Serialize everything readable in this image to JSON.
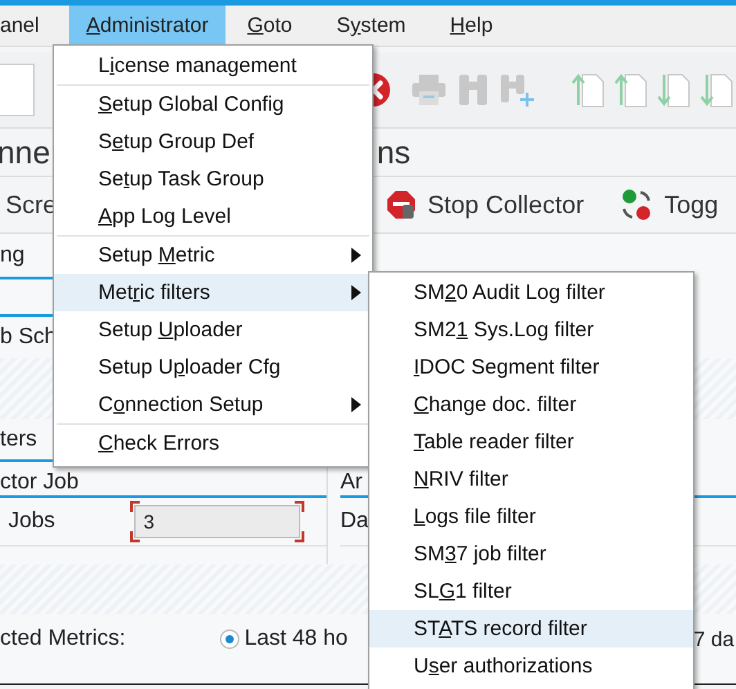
{
  "menubar": [
    {
      "text_after": "anel",
      "selected": false
    },
    {
      "key": "A",
      "text_after": "dministrator",
      "selected": true
    },
    {
      "key": "G",
      "text_after": "oto",
      "selected": false
    },
    {
      "text_before": "S",
      "key": "y",
      "text_after": "stem",
      "selected": false
    },
    {
      "key": "H",
      "text_after": "elp",
      "selected": false
    }
  ],
  "title_fragments": [
    "nne",
    "ns"
  ],
  "app_toolbar": [
    {
      "kind": "plain",
      "label": "Scre"
    },
    {
      "kind": "stop",
      "label": "Stop Collector"
    },
    {
      "kind": "toggle",
      "label": "Togg"
    }
  ],
  "content": {
    "row_1": "ng",
    "row_2": "b Sch",
    "row_3": "ters",
    "group_title": "ctor Job",
    "jobs_label": "Jobs",
    "jobs_value": "3",
    "column_2_title": "Ar",
    "column_2_label": "Da",
    "metrics_label": "cted Metrics:",
    "options": [
      {
        "label": "Last 48 ho",
        "selected": true
      },
      {
        "label": "7 da",
        "selected": false
      }
    ]
  },
  "administrator_menu": [
    {
      "kind": "item",
      "text_before": "L",
      "key": "i",
      "text_after": "cense management",
      "has_submenu": false,
      "selected": false
    },
    {
      "kind": "separator"
    },
    {
      "kind": "item",
      "key": "S",
      "text_after": "etup Global Config",
      "has_submenu": false,
      "selected": false
    },
    {
      "kind": "item",
      "text_before": "S",
      "key": "e",
      "text_after": "tup Group Def",
      "has_submenu": false,
      "selected": false
    },
    {
      "kind": "item",
      "text_before": "Se",
      "key": "t",
      "text_after": "up Task Group",
      "has_submenu": false,
      "selected": false
    },
    {
      "kind": "item",
      "key": "A",
      "text_after": "pp Log Level",
      "has_submenu": false,
      "selected": false
    },
    {
      "kind": "separator"
    },
    {
      "kind": "item",
      "text_before": "Setup ",
      "key": "M",
      "text_after": "etric",
      "has_submenu": true,
      "selected": false
    },
    {
      "kind": "item",
      "text_before": "Met",
      "key": "r",
      "text_after": "ic filters",
      "has_submenu": true,
      "selected": true
    },
    {
      "kind": "item",
      "text_before": "Setup ",
      "key": "U",
      "text_after": "ploader",
      "has_submenu": false,
      "selected": false
    },
    {
      "kind": "item",
      "text_before": "Setup U",
      "key": "p",
      "text_after": "loader Cfg",
      "has_submenu": false,
      "selected": false
    },
    {
      "kind": "item",
      "text_before": "C",
      "key": "o",
      "text_after": "nnection Setup",
      "has_submenu": true,
      "selected": false
    },
    {
      "kind": "separator"
    },
    {
      "kind": "item",
      "key": "C",
      "text_after": "heck Errors",
      "has_submenu": false,
      "selected": false
    }
  ],
  "metric_filters_menu": [
    {
      "text_before": "SM",
      "key": "2",
      "text_after": "0 Audit Log filter",
      "selected": false
    },
    {
      "text_before": "SM2",
      "key": "1",
      "text_after": " Sys.Log filter",
      "selected": false
    },
    {
      "key": "I",
      "text_after": "DOC Segment filter",
      "selected": false
    },
    {
      "key": "C",
      "text_after": "hange doc. filter",
      "selected": false
    },
    {
      "key": "T",
      "text_after": "able reader filter",
      "selected": false
    },
    {
      "key": "N",
      "text_after": "RIV filter",
      "selected": false
    },
    {
      "key": "L",
      "text_after": "ogs file filter",
      "selected": false
    },
    {
      "text_before": "SM",
      "key": "3",
      "text_after": "7 job filter",
      "selected": false
    },
    {
      "text_before": "SL",
      "key": "G",
      "text_after": "1 filter",
      "selected": false
    },
    {
      "text_before": "ST",
      "key": "A",
      "text_after": "TS record filter",
      "selected": true
    },
    {
      "text_before": "U",
      "key": "s",
      "text_after": "er authorizations",
      "selected": false
    }
  ]
}
